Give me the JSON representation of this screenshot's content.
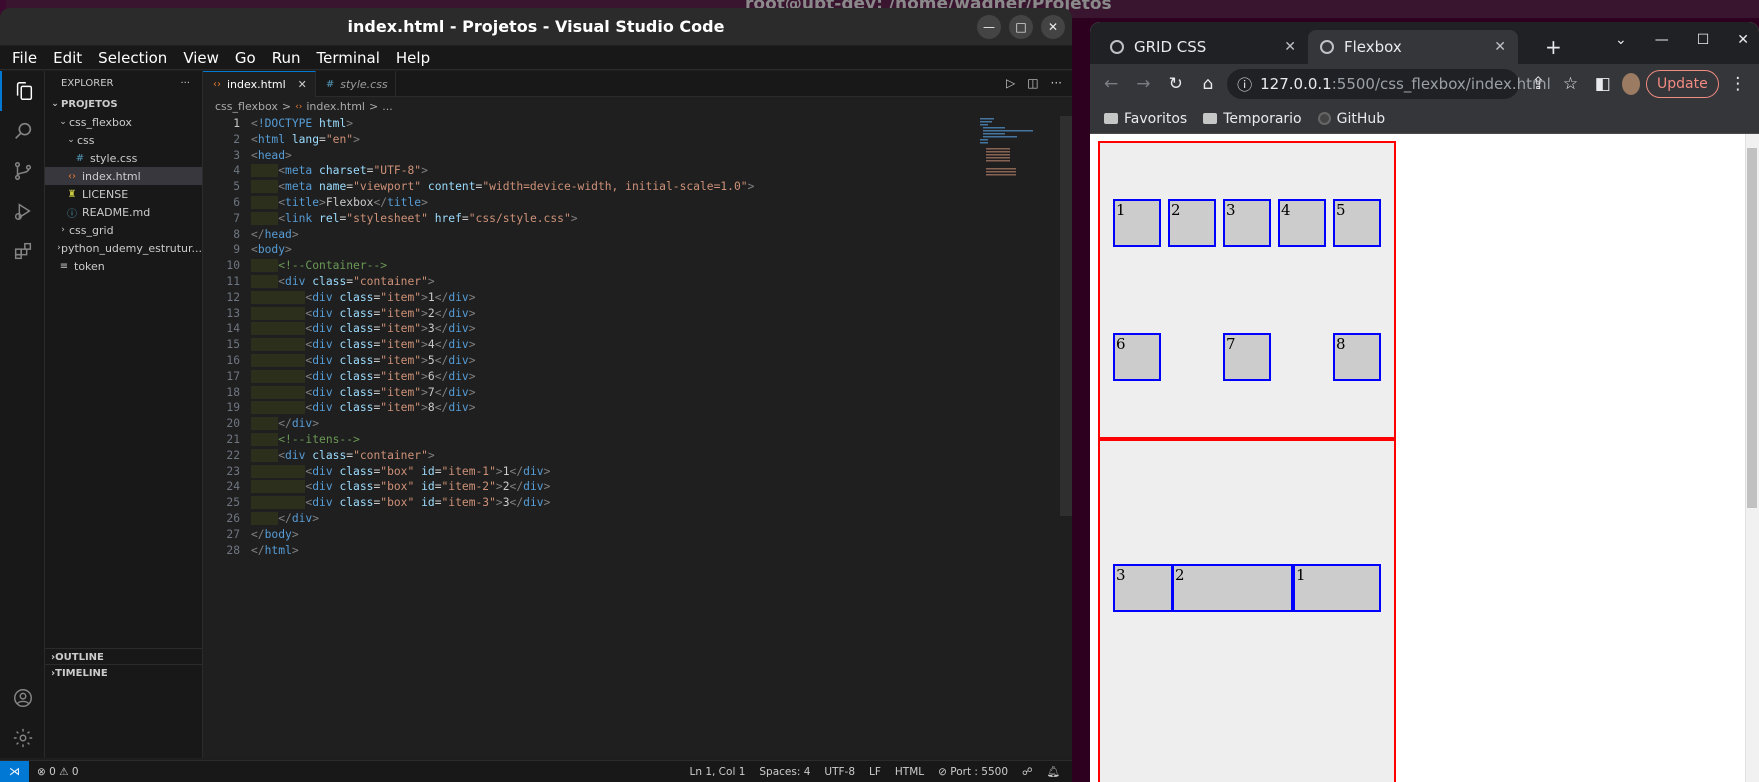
{
  "desktop": {
    "terminal_title": "root@ubt-dev: /home/wagner/Projetos"
  },
  "vscode": {
    "title": "index.html - Projetos - Visual Studio Code",
    "menu": [
      "File",
      "Edit",
      "Selection",
      "View",
      "Go",
      "Run",
      "Terminal",
      "Help"
    ],
    "explorer": {
      "header": "EXPLORER",
      "project": "PROJETOS",
      "tree": [
        {
          "label": "css_flexbox",
          "type": "folder-open",
          "depth": 1
        },
        {
          "label": "css",
          "type": "folder-open",
          "depth": 2
        },
        {
          "label": "style.css",
          "type": "css",
          "depth": 3
        },
        {
          "label": "index.html",
          "type": "html",
          "depth": 2,
          "selected": true
        },
        {
          "label": "LICENSE",
          "type": "license",
          "depth": 2
        },
        {
          "label": "README.md",
          "type": "info",
          "depth": 2
        },
        {
          "label": "css_grid",
          "type": "folder",
          "depth": 1
        },
        {
          "label": "python_udemy_estrutur...",
          "type": "folder",
          "depth": 1
        },
        {
          "label": "token",
          "type": "text",
          "depth": 1
        }
      ],
      "outline": "OUTLINE",
      "timeline": "TIMELINE"
    },
    "tabs": [
      {
        "label": "index.html",
        "active": true
      },
      {
        "label": "style.css",
        "active": false
      }
    ],
    "breadcrumb": [
      "css_flexbox",
      ">",
      "index.html",
      ">",
      "..."
    ],
    "status": {
      "problems": "⊗ 0 ⚠ 0",
      "position": "Ln 1, Col 1",
      "spaces": "Spaces: 4",
      "encoding": "UTF-8",
      "eol": "LF",
      "language": "HTML",
      "port": "⊘ Port : 5500"
    }
  },
  "code": [
    [
      [
        "t-punct",
        "<"
      ],
      [
        "t-tag",
        "!DOCTYPE"
      ],
      [
        "t-attr",
        " html"
      ],
      [
        "t-punct",
        ">"
      ]
    ],
    [
      [
        "t-punct",
        "<"
      ],
      [
        "t-tag",
        "html"
      ],
      [
        "t-attr",
        " lang"
      ],
      [
        "t-txt",
        "="
      ],
      [
        "t-str",
        "\"en\""
      ],
      [
        "t-punct",
        ">"
      ]
    ],
    [
      [
        "t-punct",
        "<"
      ],
      [
        "t-tag",
        "head"
      ],
      [
        "t-punct",
        ">"
      ]
    ],
    [
      [
        "t-txt",
        "    "
      ],
      [
        "t-punct",
        "<"
      ],
      [
        "t-tag",
        "meta"
      ],
      [
        "t-attr",
        " charset"
      ],
      [
        "t-txt",
        "="
      ],
      [
        "t-str",
        "\"UTF-8\""
      ],
      [
        "t-punct",
        ">"
      ]
    ],
    [
      [
        "t-txt",
        "    "
      ],
      [
        "t-punct",
        "<"
      ],
      [
        "t-tag",
        "meta"
      ],
      [
        "t-attr",
        " name"
      ],
      [
        "t-txt",
        "="
      ],
      [
        "t-str",
        "\"viewport\""
      ],
      [
        "t-attr",
        " content"
      ],
      [
        "t-txt",
        "="
      ],
      [
        "t-str",
        "\"width=device-width, initial-scale=1.0\""
      ],
      [
        "t-punct",
        ">"
      ]
    ],
    [
      [
        "t-txt",
        "    "
      ],
      [
        "t-punct",
        "<"
      ],
      [
        "t-tag",
        "title"
      ],
      [
        "t-punct",
        ">"
      ],
      [
        "t-txt",
        "Flexbox"
      ],
      [
        "t-punct",
        "</"
      ],
      [
        "t-tag",
        "title"
      ],
      [
        "t-punct",
        ">"
      ]
    ],
    [
      [
        "t-txt",
        "    "
      ],
      [
        "t-punct",
        "<"
      ],
      [
        "t-tag",
        "link"
      ],
      [
        "t-attr",
        " rel"
      ],
      [
        "t-txt",
        "="
      ],
      [
        "t-str",
        "\"stylesheet\""
      ],
      [
        "t-attr",
        " href"
      ],
      [
        "t-txt",
        "="
      ],
      [
        "t-str",
        "\"css/style.css\""
      ],
      [
        "t-punct",
        ">"
      ]
    ],
    [
      [
        "t-punct",
        "</"
      ],
      [
        "t-tag",
        "head"
      ],
      [
        "t-punct",
        ">"
      ]
    ],
    [
      [
        "t-punct",
        "<"
      ],
      [
        "t-tag",
        "body"
      ],
      [
        "t-punct",
        ">"
      ]
    ],
    [
      [
        "t-txt",
        "    "
      ],
      [
        "t-cmt",
        "<!--Container-->"
      ]
    ],
    [
      [
        "t-txt",
        "    "
      ],
      [
        "t-punct",
        "<"
      ],
      [
        "t-tag",
        "div"
      ],
      [
        "t-attr",
        " class"
      ],
      [
        "t-txt",
        "="
      ],
      [
        "t-str",
        "\"container\""
      ],
      [
        "t-punct",
        ">"
      ]
    ],
    [
      [
        "t-txt",
        "        "
      ],
      [
        "t-punct",
        "<"
      ],
      [
        "t-tag",
        "div"
      ],
      [
        "t-attr",
        " class"
      ],
      [
        "t-txt",
        "="
      ],
      [
        "t-str",
        "\"item\""
      ],
      [
        "t-punct",
        ">"
      ],
      [
        "t-txt",
        "1"
      ],
      [
        "t-punct",
        "</"
      ],
      [
        "t-tag",
        "div"
      ],
      [
        "t-punct",
        ">"
      ]
    ],
    [
      [
        "t-txt",
        "        "
      ],
      [
        "t-punct",
        "<"
      ],
      [
        "t-tag",
        "div"
      ],
      [
        "t-attr",
        " class"
      ],
      [
        "t-txt",
        "="
      ],
      [
        "t-str",
        "\"item\""
      ],
      [
        "t-punct",
        ">"
      ],
      [
        "t-txt",
        "2"
      ],
      [
        "t-punct",
        "</"
      ],
      [
        "t-tag",
        "div"
      ],
      [
        "t-punct",
        ">"
      ]
    ],
    [
      [
        "t-txt",
        "        "
      ],
      [
        "t-punct",
        "<"
      ],
      [
        "t-tag",
        "div"
      ],
      [
        "t-attr",
        " class"
      ],
      [
        "t-txt",
        "="
      ],
      [
        "t-str",
        "\"item\""
      ],
      [
        "t-punct",
        ">"
      ],
      [
        "t-txt",
        "3"
      ],
      [
        "t-punct",
        "</"
      ],
      [
        "t-tag",
        "div"
      ],
      [
        "t-punct",
        ">"
      ]
    ],
    [
      [
        "t-txt",
        "        "
      ],
      [
        "t-punct",
        "<"
      ],
      [
        "t-tag",
        "div"
      ],
      [
        "t-attr",
        " class"
      ],
      [
        "t-txt",
        "="
      ],
      [
        "t-str",
        "\"item\""
      ],
      [
        "t-punct",
        ">"
      ],
      [
        "t-txt",
        "4"
      ],
      [
        "t-punct",
        "</"
      ],
      [
        "t-tag",
        "div"
      ],
      [
        "t-punct",
        ">"
      ]
    ],
    [
      [
        "t-txt",
        "        "
      ],
      [
        "t-punct",
        "<"
      ],
      [
        "t-tag",
        "div"
      ],
      [
        "t-attr",
        " class"
      ],
      [
        "t-txt",
        "="
      ],
      [
        "t-str",
        "\"item\""
      ],
      [
        "t-punct",
        ">"
      ],
      [
        "t-txt",
        "5"
      ],
      [
        "t-punct",
        "</"
      ],
      [
        "t-tag",
        "div"
      ],
      [
        "t-punct",
        ">"
      ]
    ],
    [
      [
        "t-txt",
        "        "
      ],
      [
        "t-punct",
        "<"
      ],
      [
        "t-tag",
        "div"
      ],
      [
        "t-attr",
        " class"
      ],
      [
        "t-txt",
        "="
      ],
      [
        "t-str",
        "\"item\""
      ],
      [
        "t-punct",
        ">"
      ],
      [
        "t-txt",
        "6"
      ],
      [
        "t-punct",
        "</"
      ],
      [
        "t-tag",
        "div"
      ],
      [
        "t-punct",
        ">"
      ]
    ],
    [
      [
        "t-txt",
        "        "
      ],
      [
        "t-punct",
        "<"
      ],
      [
        "t-tag",
        "div"
      ],
      [
        "t-attr",
        " class"
      ],
      [
        "t-txt",
        "="
      ],
      [
        "t-str",
        "\"item\""
      ],
      [
        "t-punct",
        ">"
      ],
      [
        "t-txt",
        "7"
      ],
      [
        "t-punct",
        "</"
      ],
      [
        "t-tag",
        "div"
      ],
      [
        "t-punct",
        ">"
      ]
    ],
    [
      [
        "t-txt",
        "        "
      ],
      [
        "t-punct",
        "<"
      ],
      [
        "t-tag",
        "div"
      ],
      [
        "t-attr",
        " class"
      ],
      [
        "t-txt",
        "="
      ],
      [
        "t-str",
        "\"item\""
      ],
      [
        "t-punct",
        ">"
      ],
      [
        "t-txt",
        "8"
      ],
      [
        "t-punct",
        "</"
      ],
      [
        "t-tag",
        "div"
      ],
      [
        "t-punct",
        ">"
      ]
    ],
    [
      [
        "t-txt",
        "    "
      ],
      [
        "t-punct",
        "</"
      ],
      [
        "t-tag",
        "div"
      ],
      [
        "t-punct",
        ">"
      ]
    ],
    [
      [
        "t-txt",
        "    "
      ],
      [
        "t-cmt",
        "<!--itens-->"
      ]
    ],
    [
      [
        "t-txt",
        "    "
      ],
      [
        "t-punct",
        "<"
      ],
      [
        "t-tag",
        "div"
      ],
      [
        "t-attr",
        " class"
      ],
      [
        "t-txt",
        "="
      ],
      [
        "t-str",
        "\"container\""
      ],
      [
        "t-punct",
        ">"
      ]
    ],
    [
      [
        "t-txt",
        "        "
      ],
      [
        "t-punct",
        "<"
      ],
      [
        "t-tag",
        "div"
      ],
      [
        "t-attr",
        " class"
      ],
      [
        "t-txt",
        "="
      ],
      [
        "t-str",
        "\"box\""
      ],
      [
        "t-attr",
        " id"
      ],
      [
        "t-txt",
        "="
      ],
      [
        "t-str",
        "\"item-1\""
      ],
      [
        "t-punct",
        ">"
      ],
      [
        "t-txt",
        "1"
      ],
      [
        "t-punct",
        "</"
      ],
      [
        "t-tag",
        "div"
      ],
      [
        "t-punct",
        ">"
      ]
    ],
    [
      [
        "t-txt",
        "        "
      ],
      [
        "t-punct",
        "<"
      ],
      [
        "t-tag",
        "div"
      ],
      [
        "t-attr",
        " class"
      ],
      [
        "t-txt",
        "="
      ],
      [
        "t-str",
        "\"box\""
      ],
      [
        "t-attr",
        " id"
      ],
      [
        "t-txt",
        "="
      ],
      [
        "t-str",
        "\"item-2\""
      ],
      [
        "t-punct",
        ">"
      ],
      [
        "t-txt",
        "2"
      ],
      [
        "t-punct",
        "</"
      ],
      [
        "t-tag",
        "div"
      ],
      [
        "t-punct",
        ">"
      ]
    ],
    [
      [
        "t-txt",
        "        "
      ],
      [
        "t-punct",
        "<"
      ],
      [
        "t-tag",
        "div"
      ],
      [
        "t-attr",
        " class"
      ],
      [
        "t-txt",
        "="
      ],
      [
        "t-str",
        "\"box\""
      ],
      [
        "t-attr",
        " id"
      ],
      [
        "t-txt",
        "="
      ],
      [
        "t-str",
        "\"item-3\""
      ],
      [
        "t-punct",
        ">"
      ],
      [
        "t-txt",
        "3"
      ],
      [
        "t-punct",
        "</"
      ],
      [
        "t-tag",
        "div"
      ],
      [
        "t-punct",
        ">"
      ]
    ],
    [
      [
        "t-txt",
        "    "
      ],
      [
        "t-punct",
        "</"
      ],
      [
        "t-tag",
        "div"
      ],
      [
        "t-punct",
        ">"
      ]
    ],
    [
      [
        "t-punct",
        "</"
      ],
      [
        "t-tag",
        "body"
      ],
      [
        "t-punct",
        ">"
      ]
    ],
    [
      [
        "t-punct",
        "</"
      ],
      [
        "t-tag",
        "html"
      ],
      [
        "t-punct",
        ">"
      ]
    ]
  ],
  "chrome": {
    "tabs": [
      {
        "label": "GRID CSS",
        "active": false
      },
      {
        "label": "Flexbox",
        "active": true
      }
    ],
    "url_host": "127.0.0.1",
    "url_path": ":5500/css_flexbox/index.html",
    "update_label": "Update",
    "bookmarks": [
      "Favoritos",
      "Temporario",
      "GitHub"
    ],
    "page": {
      "container1_items": [
        "1",
        "2",
        "3",
        "4",
        "5",
        "6",
        "7",
        "8"
      ],
      "container2_items": [
        "3",
        "2",
        "1"
      ]
    }
  },
  "colors": {
    "accent": "#0078d4",
    "container_border": "#ff0000",
    "item_border": "#0000ff",
    "item_fill": "#cccccc"
  }
}
